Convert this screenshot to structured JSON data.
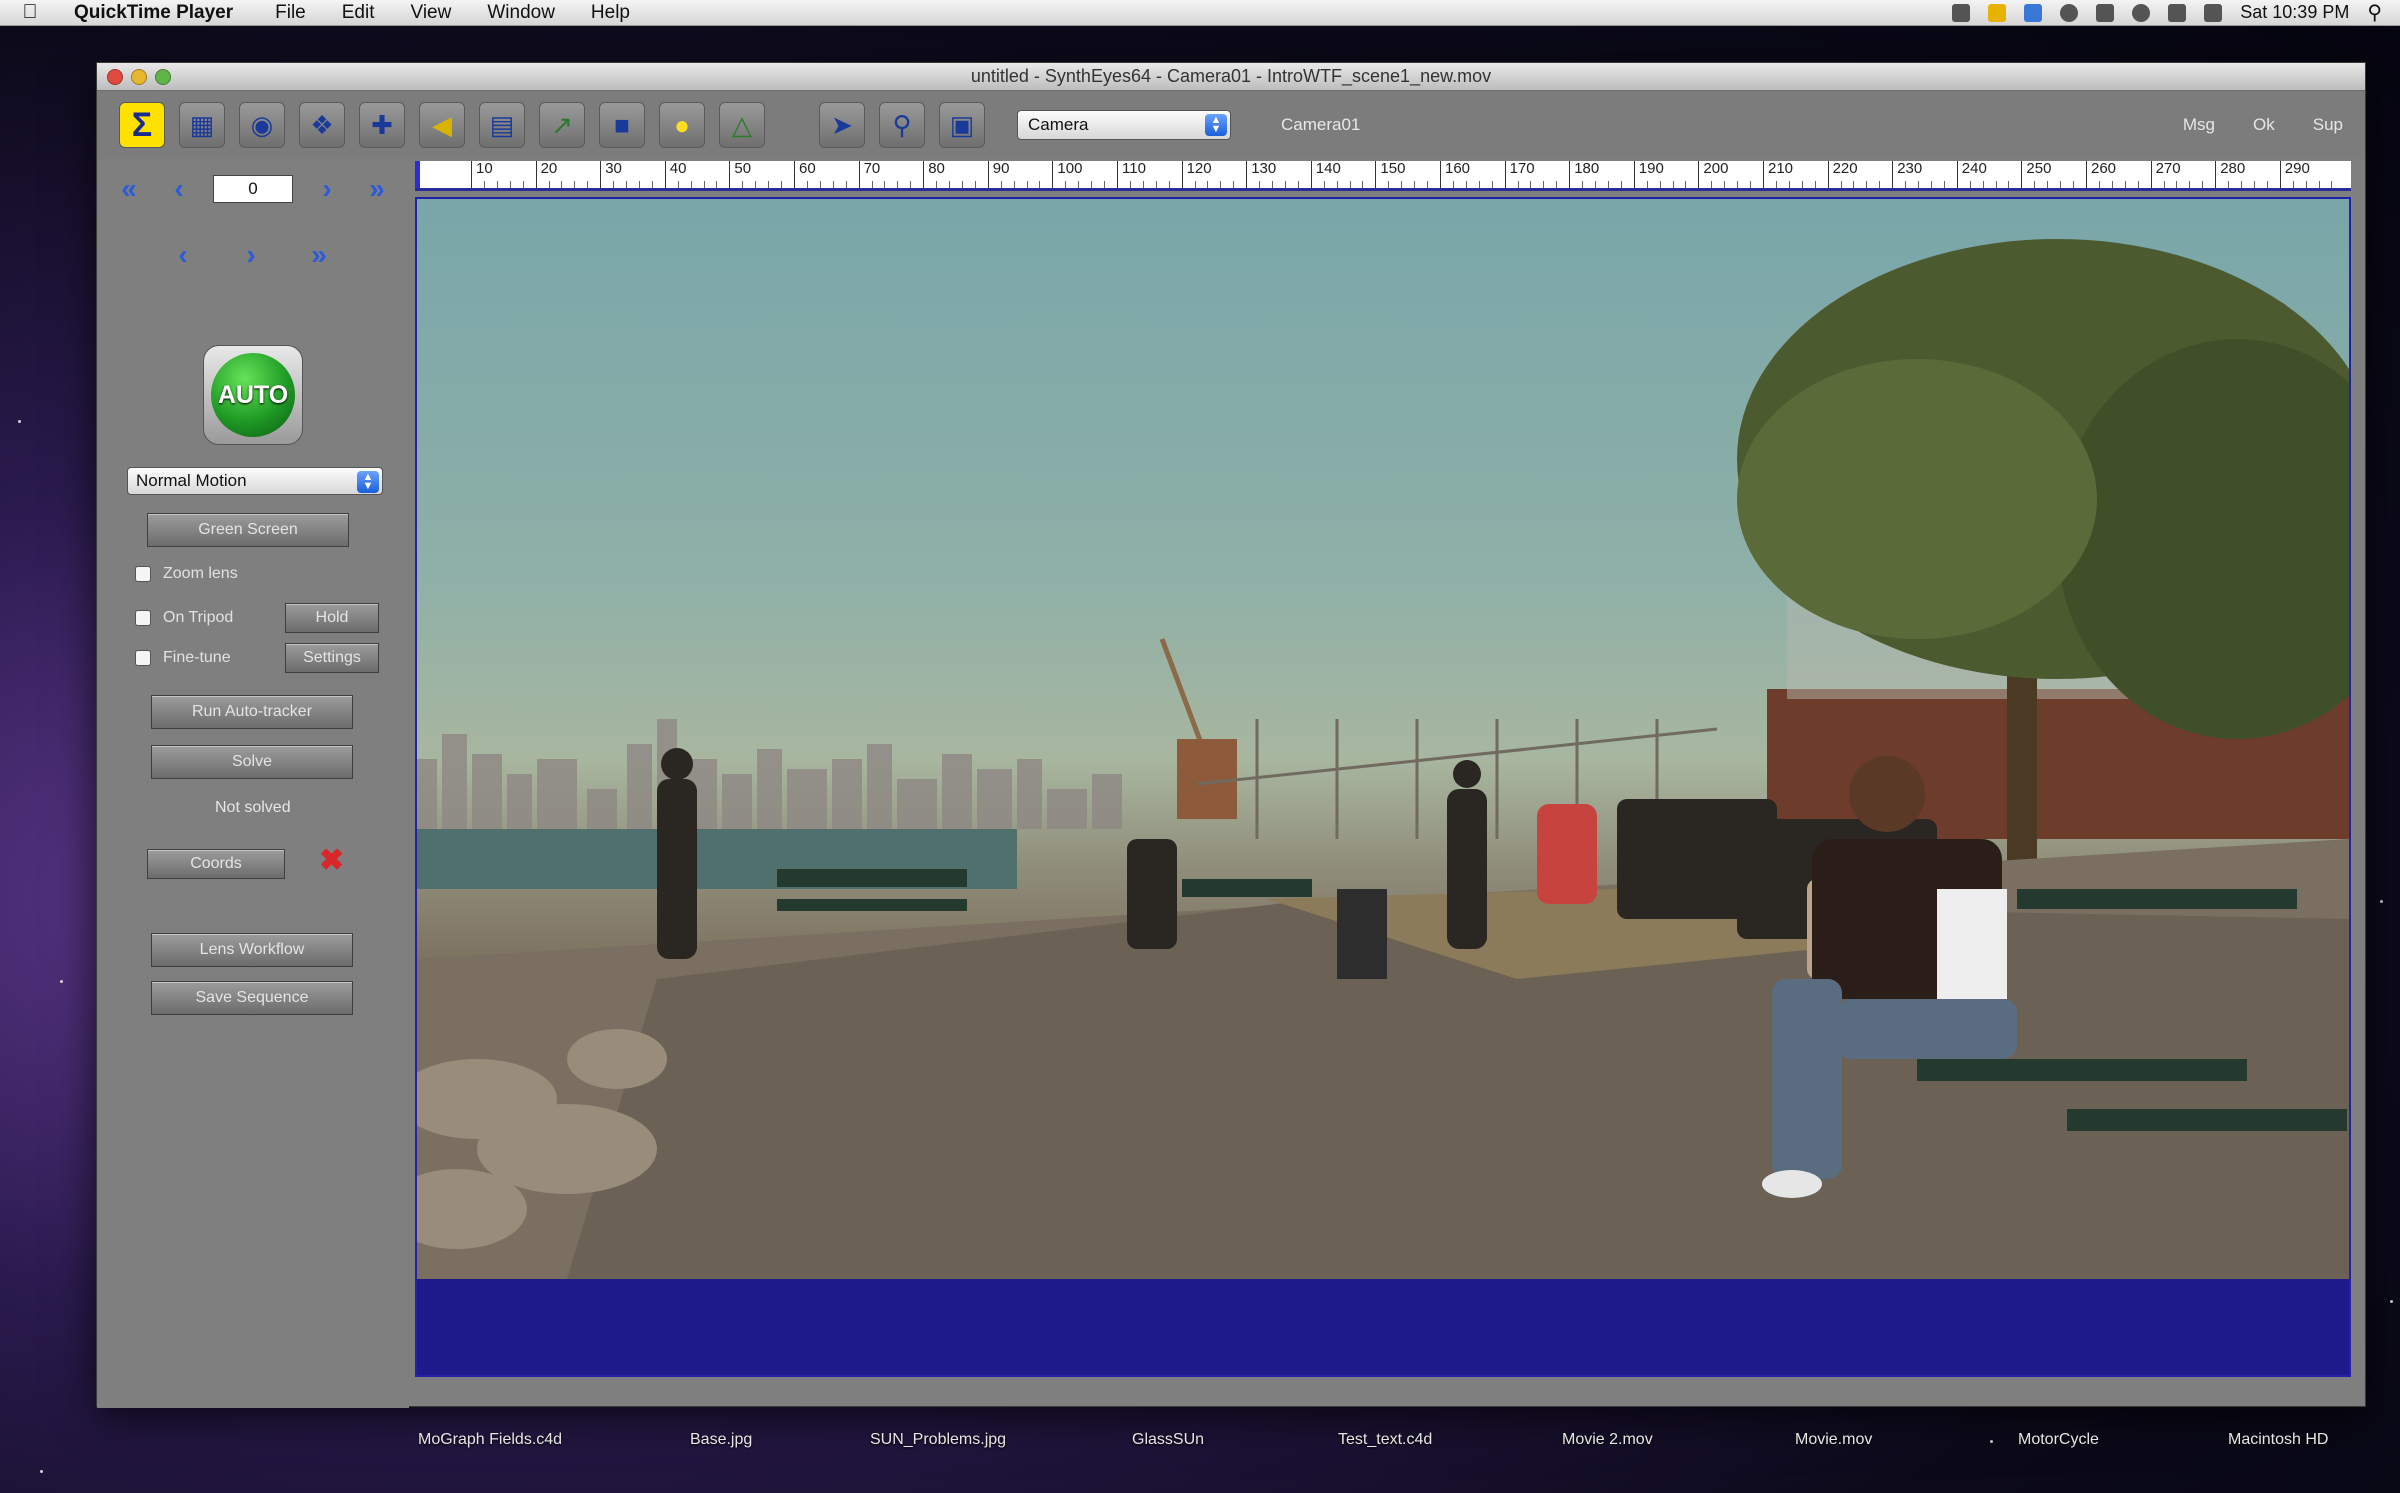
{
  "menubar": {
    "app_name": "QuickTime Player",
    "items": [
      "File",
      "Edit",
      "View",
      "Window",
      "Help"
    ],
    "clock": "Sat 10:39 PM"
  },
  "window": {
    "title": "untitled - SynthEyes64 - Camera01 - IntroWTF_scene1_new.mov"
  },
  "toolbar": {
    "room_select_value": "Camera",
    "camera_name": "Camera01",
    "right_labels": [
      "Msg",
      "Ok",
      "Sup"
    ],
    "icons": [
      "sigma-icon",
      "summary-room-icon",
      "tracker-room-icon",
      "3d-room-icon",
      "coordinate-room-icon",
      "solve-room-icon",
      "notes-icon",
      "graph-icon",
      "perspective-icon",
      "lightbulb-icon",
      "phase-icon",
      "forward-arrow-icon",
      "zoom-icon",
      "frame-fit-icon"
    ]
  },
  "playback": {
    "frame_value": "0"
  },
  "panel": {
    "auto_label": "AUTO",
    "motion_select": "Normal Motion",
    "green_screen": "Green Screen",
    "zoom_lens": "Zoom lens",
    "on_tripod": "On Tripod",
    "hold": "Hold",
    "fine_tune": "Fine-tune",
    "settings": "Settings",
    "run_autotracker": "Run Auto-tracker",
    "solve": "Solve",
    "status": "Not solved",
    "coords": "Coords",
    "lens_workflow": "Lens Workflow",
    "save_sequence": "Save Sequence"
  },
  "timeline": {
    "labels": [
      "10",
      "20",
      "30",
      "40",
      "50",
      "60",
      "70",
      "80",
      "90",
      "100",
      "110",
      "120",
      "130",
      "140",
      "150",
      "160",
      "170",
      "180",
      "190",
      "200",
      "210",
      "220",
      "230",
      "240",
      "250",
      "260",
      "270",
      "280",
      "290"
    ],
    "current_frame": 0
  },
  "desktop": {
    "icons": [
      "MoGraph Fields.c4d",
      "Base.jpg",
      "SUN_Problems.jpg",
      "GlassSUn",
      "Test_text.c4d",
      "Movie 2.mov",
      "Movie.mov",
      "MotorCycle",
      "Macintosh HD"
    ]
  }
}
